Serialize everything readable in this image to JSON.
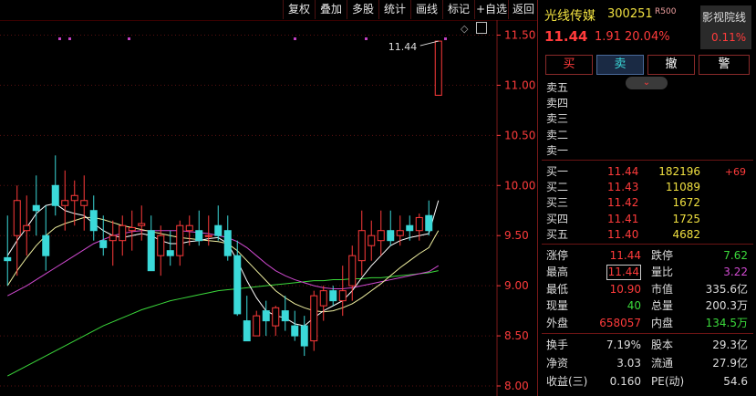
{
  "toolbar": {
    "buttons": [
      "复权",
      "叠加",
      "多股",
      "统计",
      "画线",
      "标记",
      "+自选",
      "返回"
    ]
  },
  "stock": {
    "name": "光线传媒",
    "code": "300251",
    "badge": "R500",
    "price": "11.44",
    "change": "1.91",
    "change_pct": "20.04%",
    "sector_name": "影视院线",
    "sector_pct": "0.11%"
  },
  "actions": {
    "buy": "买",
    "sell": "卖",
    "cancel": "撤",
    "alert": "警"
  },
  "expand_icon": "chevron-down-icon",
  "sell_book": [
    {
      "label": "卖五",
      "price": "",
      "volume": "",
      "delta": ""
    },
    {
      "label": "卖四",
      "price": "",
      "volume": "",
      "delta": ""
    },
    {
      "label": "卖三",
      "price": "",
      "volume": "",
      "delta": ""
    },
    {
      "label": "卖二",
      "price": "",
      "volume": "",
      "delta": ""
    },
    {
      "label": "卖一",
      "price": "",
      "volume": "",
      "delta": ""
    }
  ],
  "buy_book": [
    {
      "label": "买一",
      "price": "11.44",
      "volume": "182196",
      "delta": "+69"
    },
    {
      "label": "买二",
      "price": "11.43",
      "volume": "11089",
      "delta": ""
    },
    {
      "label": "买三",
      "price": "11.42",
      "volume": "1672",
      "delta": ""
    },
    {
      "label": "买四",
      "price": "11.41",
      "volume": "1725",
      "delta": ""
    },
    {
      "label": "买五",
      "price": "11.40",
      "volume": "4682",
      "delta": ""
    }
  ],
  "stats1": [
    {
      "l1": "涨停",
      "v1": "11.44",
      "c1": "#ff3b3b",
      "l2": "跌停",
      "v2": "7.62",
      "c2": "#3bd93b"
    },
    {
      "l1": "最高",
      "v1": "11.44",
      "c1": "#ff3b3b",
      "l2": "量比",
      "v2": "3.22",
      "c2": "#d04ad0"
    },
    {
      "l1": "最低",
      "v1": "10.90",
      "c1": "#ff3b3b",
      "l2": "市值",
      "v2": "335.6亿",
      "c2": "#dddddd"
    },
    {
      "l1": "现量",
      "v1": "40",
      "c1": "#3bd93b",
      "l2": "总量",
      "v2": "200.3万",
      "c2": "#dddddd"
    },
    {
      "l1": "外盘",
      "v1": "658057",
      "c1": "#ff3b3b",
      "l2": "内盘",
      "v2": "134.5万",
      "c2": "#3bd93b"
    }
  ],
  "stats2": [
    {
      "l1": "换手",
      "v1": "7.19%",
      "l2": "股本",
      "v2": "29.3亿"
    },
    {
      "l1": "净资",
      "v1": "3.03",
      "l2": "流通",
      "v2": "27.9亿"
    },
    {
      "l1": "收益(三)",
      "v1": "0.160",
      "l2": "PE(动)",
      "v2": "54.6"
    }
  ],
  "colors": {
    "up": "#ff3b3b",
    "down": "#3bd9d9",
    "ma5": "#ffffff",
    "ma10": "#f0f0a0",
    "ma20": "#d04ad0",
    "ma60": "#3bd93b",
    "axis": "#ff3b3b",
    "grid": "#5a1010"
  },
  "chart_data": {
    "type": "candlestick",
    "y_ticks": [
      "11.50",
      "11.00",
      "10.50",
      "10.00",
      "9.50",
      "9.00",
      "8.50",
      "8.00"
    ],
    "ylim": [
      7.9,
      11.65
    ],
    "high_label": "11.44",
    "candles": [
      {
        "o": 9.28,
        "h": 9.7,
        "l": 9.0,
        "c": 9.25
      },
      {
        "o": 9.5,
        "h": 10.0,
        "l": 9.1,
        "c": 9.85
      },
      {
        "o": 9.55,
        "h": 9.9,
        "l": 9.3,
        "c": 9.6
      },
      {
        "o": 9.8,
        "h": 10.1,
        "l": 9.5,
        "c": 9.75
      },
      {
        "o": 9.5,
        "h": 9.8,
        "l": 9.15,
        "c": 9.3
      },
      {
        "o": 10.0,
        "h": 10.3,
        "l": 9.7,
        "c": 9.8
      },
      {
        "o": 9.8,
        "h": 10.15,
        "l": 9.55,
        "c": 9.85
      },
      {
        "o": 9.85,
        "h": 10.05,
        "l": 9.6,
        "c": 9.9
      },
      {
        "o": 9.8,
        "h": 10.1,
        "l": 9.55,
        "c": 9.85
      },
      {
        "o": 9.75,
        "h": 9.9,
        "l": 9.45,
        "c": 9.55
      },
      {
        "o": 9.45,
        "h": 9.7,
        "l": 9.3,
        "c": 9.38
      },
      {
        "o": 9.45,
        "h": 9.65,
        "l": 9.2,
        "c": 9.5
      },
      {
        "o": 9.45,
        "h": 9.7,
        "l": 9.3,
        "c": 9.6
      },
      {
        "o": 9.55,
        "h": 9.75,
        "l": 9.35,
        "c": 9.58
      },
      {
        "o": 9.6,
        "h": 9.8,
        "l": 9.45,
        "c": 9.62
      },
      {
        "o": 9.55,
        "h": 9.7,
        "l": 9.2,
        "c": 9.15
      },
      {
        "o": 9.3,
        "h": 9.6,
        "l": 9.1,
        "c": 9.5
      },
      {
        "o": 9.35,
        "h": 9.55,
        "l": 9.2,
        "c": 9.3
      },
      {
        "o": 9.3,
        "h": 9.65,
        "l": 9.2,
        "c": 9.6
      },
      {
        "o": 9.55,
        "h": 9.7,
        "l": 9.4,
        "c": 9.6
      },
      {
        "o": 9.55,
        "h": 9.75,
        "l": 9.4,
        "c": 9.45
      },
      {
        "o": 9.5,
        "h": 9.7,
        "l": 9.4,
        "c": 9.5
      },
      {
        "o": 9.6,
        "h": 9.8,
        "l": 9.45,
        "c": 9.5
      },
      {
        "o": 9.55,
        "h": 9.7,
        "l": 9.25,
        "c": 9.3
      },
      {
        "o": 9.3,
        "h": 9.45,
        "l": 8.7,
        "c": 8.72
      },
      {
        "o": 8.65,
        "h": 8.9,
        "l": 8.45,
        "c": 8.45
      },
      {
        "o": 8.5,
        "h": 8.75,
        "l": 8.5,
        "c": 8.7
      },
      {
        "o": 8.75,
        "h": 8.85,
        "l": 8.5,
        "c": 8.65
      },
      {
        "o": 8.6,
        "h": 8.8,
        "l": 8.5,
        "c": 8.78
      },
      {
        "o": 8.75,
        "h": 8.9,
        "l": 8.55,
        "c": 8.65
      },
      {
        "o": 8.6,
        "h": 8.75,
        "l": 8.45,
        "c": 8.5
      },
      {
        "o": 8.6,
        "h": 8.7,
        "l": 8.3,
        "c": 8.4
      },
      {
        "o": 8.45,
        "h": 8.95,
        "l": 8.35,
        "c": 8.9
      },
      {
        "o": 8.8,
        "h": 9.0,
        "l": 8.65,
        "c": 8.95
      },
      {
        "o": 8.95,
        "h": 9.0,
        "l": 8.8,
        "c": 8.85
      },
      {
        "o": 8.85,
        "h": 9.2,
        "l": 8.7,
        "c": 8.95
      },
      {
        "o": 9.0,
        "h": 9.4,
        "l": 8.85,
        "c": 9.3
      },
      {
        "o": 9.25,
        "h": 9.75,
        "l": 9.1,
        "c": 9.55
      },
      {
        "o": 9.4,
        "h": 9.65,
        "l": 9.25,
        "c": 9.5
      },
      {
        "o": 9.45,
        "h": 9.75,
        "l": 9.3,
        "c": 9.55
      },
      {
        "o": 9.55,
        "h": 9.75,
        "l": 9.4,
        "c": 9.45
      },
      {
        "o": 9.5,
        "h": 9.7,
        "l": 9.4,
        "c": 9.55
      },
      {
        "o": 9.6,
        "h": 9.7,
        "l": 9.45,
        "c": 9.55
      },
      {
        "o": 9.55,
        "h": 9.72,
        "l": 9.45,
        "c": 9.68
      },
      {
        "o": 9.7,
        "h": 9.85,
        "l": 9.5,
        "c": 9.55
      },
      {
        "o": 10.9,
        "h": 11.44,
        "l": 10.9,
        "c": 11.44
      }
    ],
    "ma5": [
      9.3,
      9.45,
      9.58,
      9.72,
      9.8,
      9.82,
      9.75,
      9.72,
      9.7,
      9.62,
      9.55,
      9.5,
      9.48,
      9.5,
      9.52,
      9.5,
      9.45,
      9.42,
      9.42,
      9.44,
      9.45,
      9.47,
      9.48,
      9.42,
      9.25,
      9.05,
      8.88,
      8.75,
      8.7,
      8.68,
      8.62,
      8.6,
      8.68,
      8.75,
      8.8,
      8.85,
      8.95,
      9.08,
      9.2,
      9.3,
      9.4,
      9.45,
      9.48,
      9.5,
      9.52,
      9.85
    ],
    "ma10": [
      9.0,
      9.15,
      9.28,
      9.4,
      9.5,
      9.58,
      9.62,
      9.65,
      9.68,
      9.68,
      9.66,
      9.63,
      9.6,
      9.58,
      9.56,
      9.54,
      9.52,
      9.5,
      9.48,
      9.47,
      9.46,
      9.45,
      9.44,
      9.42,
      9.35,
      9.25,
      9.15,
      9.05,
      8.95,
      8.88,
      8.82,
      8.78,
      8.75,
      8.74,
      8.75,
      8.78,
      8.82,
      8.88,
      8.95,
      9.02,
      9.1,
      9.18,
      9.25,
      9.32,
      9.38,
      9.55
    ],
    "ma20": [
      8.9,
      8.95,
      9.0,
      9.06,
      9.12,
      9.18,
      9.24,
      9.3,
      9.36,
      9.42,
      9.46,
      9.5,
      9.52,
      9.54,
      9.55,
      9.55,
      9.55,
      9.55,
      9.55,
      9.54,
      9.53,
      9.52,
      9.5,
      9.48,
      9.44,
      9.38,
      9.3,
      9.22,
      9.15,
      9.1,
      9.06,
      9.03,
      9.0,
      8.98,
      8.97,
      8.97,
      8.98,
      9.0,
      9.02,
      9.04,
      9.06,
      9.08,
      9.1,
      9.12,
      9.14,
      9.2
    ],
    "ma60": [
      8.1,
      8.15,
      8.2,
      8.25,
      8.3,
      8.35,
      8.4,
      8.45,
      8.5,
      8.55,
      8.6,
      8.64,
      8.68,
      8.72,
      8.76,
      8.79,
      8.82,
      8.85,
      8.87,
      8.89,
      8.91,
      8.93,
      8.95,
      8.96,
      8.97,
      8.98,
      8.99,
      9.0,
      9.01,
      9.02,
      9.03,
      9.04,
      9.05,
      9.05,
      9.06,
      9.06,
      9.07,
      9.07,
      9.08,
      9.08,
      9.09,
      9.1,
      9.11,
      9.12,
      9.13,
      9.15
    ]
  }
}
